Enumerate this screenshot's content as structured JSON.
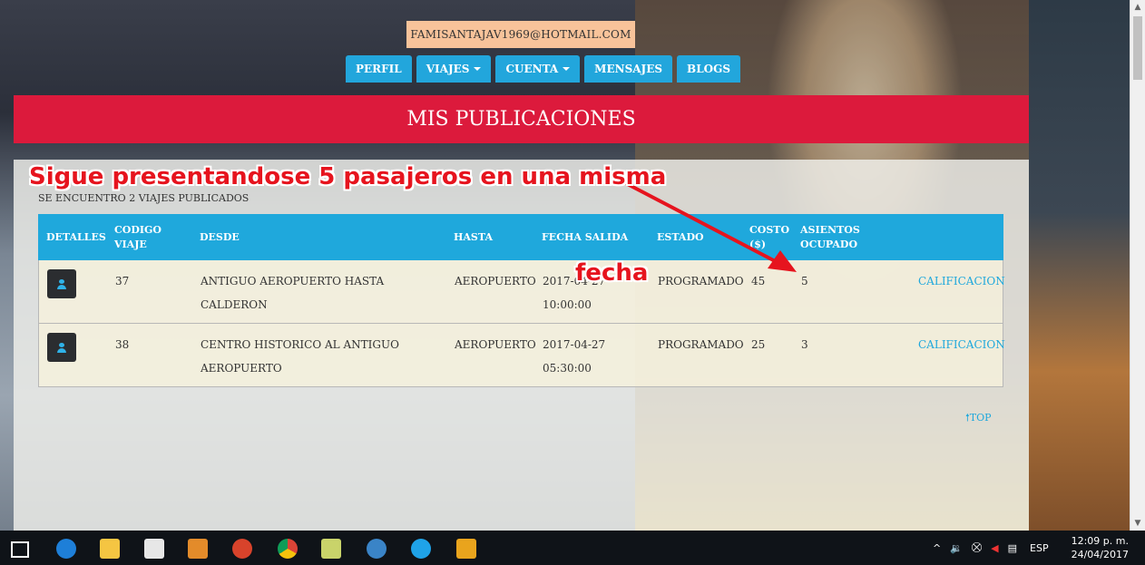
{
  "account": {
    "email": "FAMISANTAJAV1969@HOTMAIL.COM"
  },
  "nav": [
    {
      "label": "PERFIL",
      "dropdown": false
    },
    {
      "label": "VIAJES",
      "dropdown": true
    },
    {
      "label": "CUENTA",
      "dropdown": true
    },
    {
      "label": "MENSAJES",
      "dropdown": false
    },
    {
      "label": "BLOGS",
      "dropdown": false
    }
  ],
  "page_title": "MIS PUBLICACIONES",
  "summary": "SE ENCUENTRO 2 VIAJES PUBLICADOS",
  "table": {
    "headers": {
      "detalles": "DETALLES",
      "codigo_1": "CODIGO",
      "codigo_2": "VIAJE",
      "desde": "DESDE",
      "hasta": "HASTA",
      "fecha": "FECHA SALIDA",
      "estado": "ESTADO",
      "costo_1": "COSTO",
      "costo_2": "($)",
      "asientos_1": "ASIENTOS",
      "asientos_2": "OCUPADO"
    },
    "rows": [
      {
        "codigo": "37",
        "desde_1": "ANTIGUO AEROPUERTO HASTA CALDERON",
        "desde_2": "",
        "hasta": "AEROPUERTO",
        "fecha_1": "2017-04-27",
        "fecha_2": "10:00:00",
        "estado": "PROGRAMADO",
        "costo": "45",
        "asientos": "5",
        "accion": "CALIFICACION"
      },
      {
        "codigo": "38",
        "desde_1": "CENTRO HISTORICO AL ANTIGUO",
        "desde_2": "AEROPUERTO",
        "hasta": "AEROPUERTO",
        "fecha_1": "2017-04-27",
        "fecha_2": "05:30:00",
        "estado": "PROGRAMADO",
        "costo": "25",
        "asientos": "3",
        "accion": "CALIFICACION"
      }
    ]
  },
  "top_link": "TOP",
  "annotation": {
    "line1": "Sigue presentandose 5 pasajeros en una misma",
    "line2": "fecha",
    "color": "#e6141e"
  },
  "taskbar": {
    "lang": "ESP",
    "time": "12:09 p. m.",
    "date": "24/04/2017",
    "apps": [
      "task-view-icon",
      "edge-icon",
      "file-explorer-icon",
      "store-icon",
      "media-player-icon",
      "app-icon",
      "chrome-icon",
      "folder-app-icon",
      "globe-app-icon",
      "skype-icon",
      "winamp-icon"
    ]
  },
  "colors": {
    "accent": "#1fa8dc",
    "banner": "#dc1a3c",
    "email_bg": "#f8c39a"
  }
}
